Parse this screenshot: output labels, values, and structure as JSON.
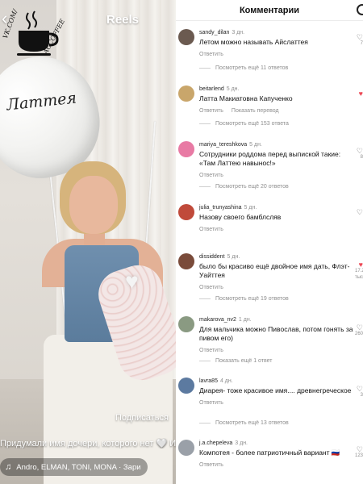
{
  "reel": {
    "title": "Reels",
    "logo_text": "VK.COM/",
    "logo_text2": "ACCOFFEE",
    "balloon_text": "Латтея",
    "subscribe": "Подписаться",
    "caption": "Придумали имя дочери, которого нет 🤍 Им",
    "music": "Andro, ELMAN, TONI, MONA · Зари"
  },
  "panel": {
    "title": "Комментарии"
  },
  "comments": [
    {
      "user": "sandy_dilan",
      "time": "3 дн.",
      "text": "Летом можно называть Айслаттея",
      "actions": [
        "Ответить"
      ],
      "more": "Посмотреть ещё 11 ответов",
      "side_count": "7",
      "avatar_color": "#6b5a50"
    },
    {
      "user": "beitarlend",
      "time": "5 дн.",
      "text": "Латта Макиатовна Капученко",
      "actions": [
        "Ответить",
        "Показать перевод"
      ],
      "more": "Посмотреть ещё 153 ответа",
      "side_count": "",
      "avatar_color": "#c9a66b"
    },
    {
      "user": "mariya_tereshkova",
      "time": "5 дн.",
      "text": "Сотрудники роддома перед выпиской такие: «Там Латтею навынос!»",
      "actions": [
        "Ответить"
      ],
      "more": "Посмотреть ещё 20 ответов",
      "side_count": "8",
      "avatar_color": "#e87aa4"
    },
    {
      "user": "julia_trunyashina",
      "time": "5 дн.",
      "text": "Назову своего бамблсляв",
      "actions": [
        "Ответить"
      ],
      "more": "",
      "side_count": "",
      "avatar_color": "#c04a3a"
    },
    {
      "user": "dissiddent",
      "time": "5 дн.",
      "text": "было бы красиво ещё двойное имя дать, Флэт-Уайттея",
      "actions": [
        "Ответить"
      ],
      "more": "Посмотреть ещё 19 ответов",
      "side_count": "17.2 тыс.",
      "avatar_color": "#7a4b3a"
    },
    {
      "user": "makarova_nv2",
      "time": "1 дн.",
      "text": "Для мальчика можно Пивослав, потом гонять за пивом его)",
      "actions": [
        "Ответить"
      ],
      "more": "Показать ещё 1 ответ",
      "side_count": "260",
      "avatar_color": "#8a9a82"
    },
    {
      "user": "lavra85",
      "time": "4 дн.",
      "text": "Диарея- тоже красивое имя.... древнегреческое",
      "actions": [
        "Ответить"
      ],
      "more": "Посмотреть ещё 13 ответов",
      "side_count": "3",
      "avatar_color": "#5c7aa0"
    },
    {
      "user": "j.a.chepeleva",
      "time": "3 дн.",
      "text": "Компотея - более патриотичный вариант 🇷🇺",
      "actions": [
        "Ответить"
      ],
      "more": "",
      "side_count": "123",
      "avatar_color": "#9aa0a8"
    }
  ]
}
